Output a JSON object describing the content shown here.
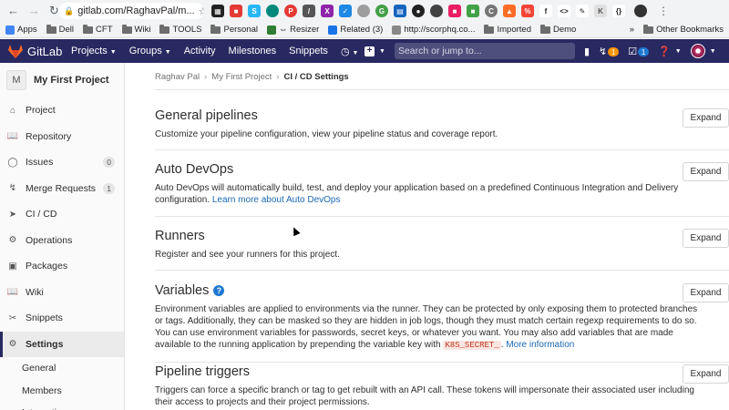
{
  "browser": {
    "url": "gitlab.com/RaghavPal/m...",
    "bookmarks": [
      {
        "label": "Apps",
        "color": "#4285f4"
      },
      {
        "label": "Dell",
        "folder": true
      },
      {
        "label": "CFT",
        "folder": true
      },
      {
        "label": "Wiki",
        "folder": true
      },
      {
        "label": "TOOLS",
        "folder": true
      },
      {
        "label": "Personal",
        "folder": true
      },
      {
        "label": "⇔ Resizer",
        "color": "#2e7d32"
      },
      {
        "label": "Related (3)",
        "color": "#1a73e8"
      },
      {
        "label": "http://scorphq.co...",
        "color": "#888888"
      },
      {
        "label": "Imported",
        "folder": true
      },
      {
        "label": "Demo",
        "folder": true
      }
    ],
    "other_bookmarks": "Other Bookmarks"
  },
  "gitlab_nav": {
    "brand": "GitLab",
    "menu": [
      "Projects",
      "Groups",
      "Activity",
      "Milestones",
      "Snippets"
    ],
    "search_placeholder": "Search or jump to...",
    "merge_requests_count": "1",
    "todos_count": "1"
  },
  "sidebar": {
    "project_initial": "M",
    "project_name": "My First Project",
    "items": [
      {
        "label": "Project",
        "icon": "home-icon"
      },
      {
        "label": "Repository",
        "icon": "book-icon"
      },
      {
        "label": "Issues",
        "icon": "issues-icon",
        "count": "0"
      },
      {
        "label": "Merge Requests",
        "icon": "merge-request-icon",
        "count": "1"
      },
      {
        "label": "CI / CD",
        "icon": "rocket-icon"
      },
      {
        "label": "Operations",
        "icon": "cloud-gear-icon"
      },
      {
        "label": "Packages",
        "icon": "package-icon"
      },
      {
        "label": "Wiki",
        "icon": "book-icon"
      },
      {
        "label": "Snippets",
        "icon": "scissors-icon"
      },
      {
        "label": "Settings",
        "icon": "gear-icon",
        "active": true
      }
    ],
    "settings_sub": [
      "General",
      "Members",
      "Integrations"
    ]
  },
  "breadcrumb": [
    "Raghav Pal",
    "My First Project",
    "CI / CD Settings"
  ],
  "sections": {
    "general_pipelines": {
      "title": "General pipelines",
      "desc": "Customize your pipeline configuration, view your pipeline status and coverage report.",
      "button": "Expand"
    },
    "auto_devops": {
      "title": "Auto DevOps",
      "desc": "Auto DevOps will automatically build, test, and deploy your application based on a predefined Continuous Integration and Delivery configuration.",
      "link": "Learn more about Auto DevOps",
      "button": "Expand"
    },
    "runners": {
      "title": "Runners",
      "desc": "Register and see your runners for this project.",
      "button": "Expand"
    },
    "variables": {
      "title": "Variables",
      "desc": "Environment variables are applied to environments via the runner. They can be protected by only exposing them to protected branches or tags. Additionally, they can be masked so they are hidden in job logs, though they must match certain regexp requirements to do so. You can use environment variables for passwords, secret keys, or whatever you want. You may also add variables that are made available to the running application by prepending the variable key with",
      "code": "K8S_SECRET_",
      "desc_end": ".",
      "link": "More information",
      "button": "Expand"
    },
    "pipeline_triggers": {
      "title": "Pipeline triggers",
      "desc": "Triggers can force a specific branch or tag to get rebuilt with an API call. These tokens will impersonate their associated user including their access to projects and their project permissions.",
      "button": "Expand"
    }
  },
  "colors": {
    "gitlab_nav_bg": "#292961",
    "link": "#1b69b6",
    "help_icon": "#1f78d1",
    "badge_orange": "#fc9403"
  }
}
